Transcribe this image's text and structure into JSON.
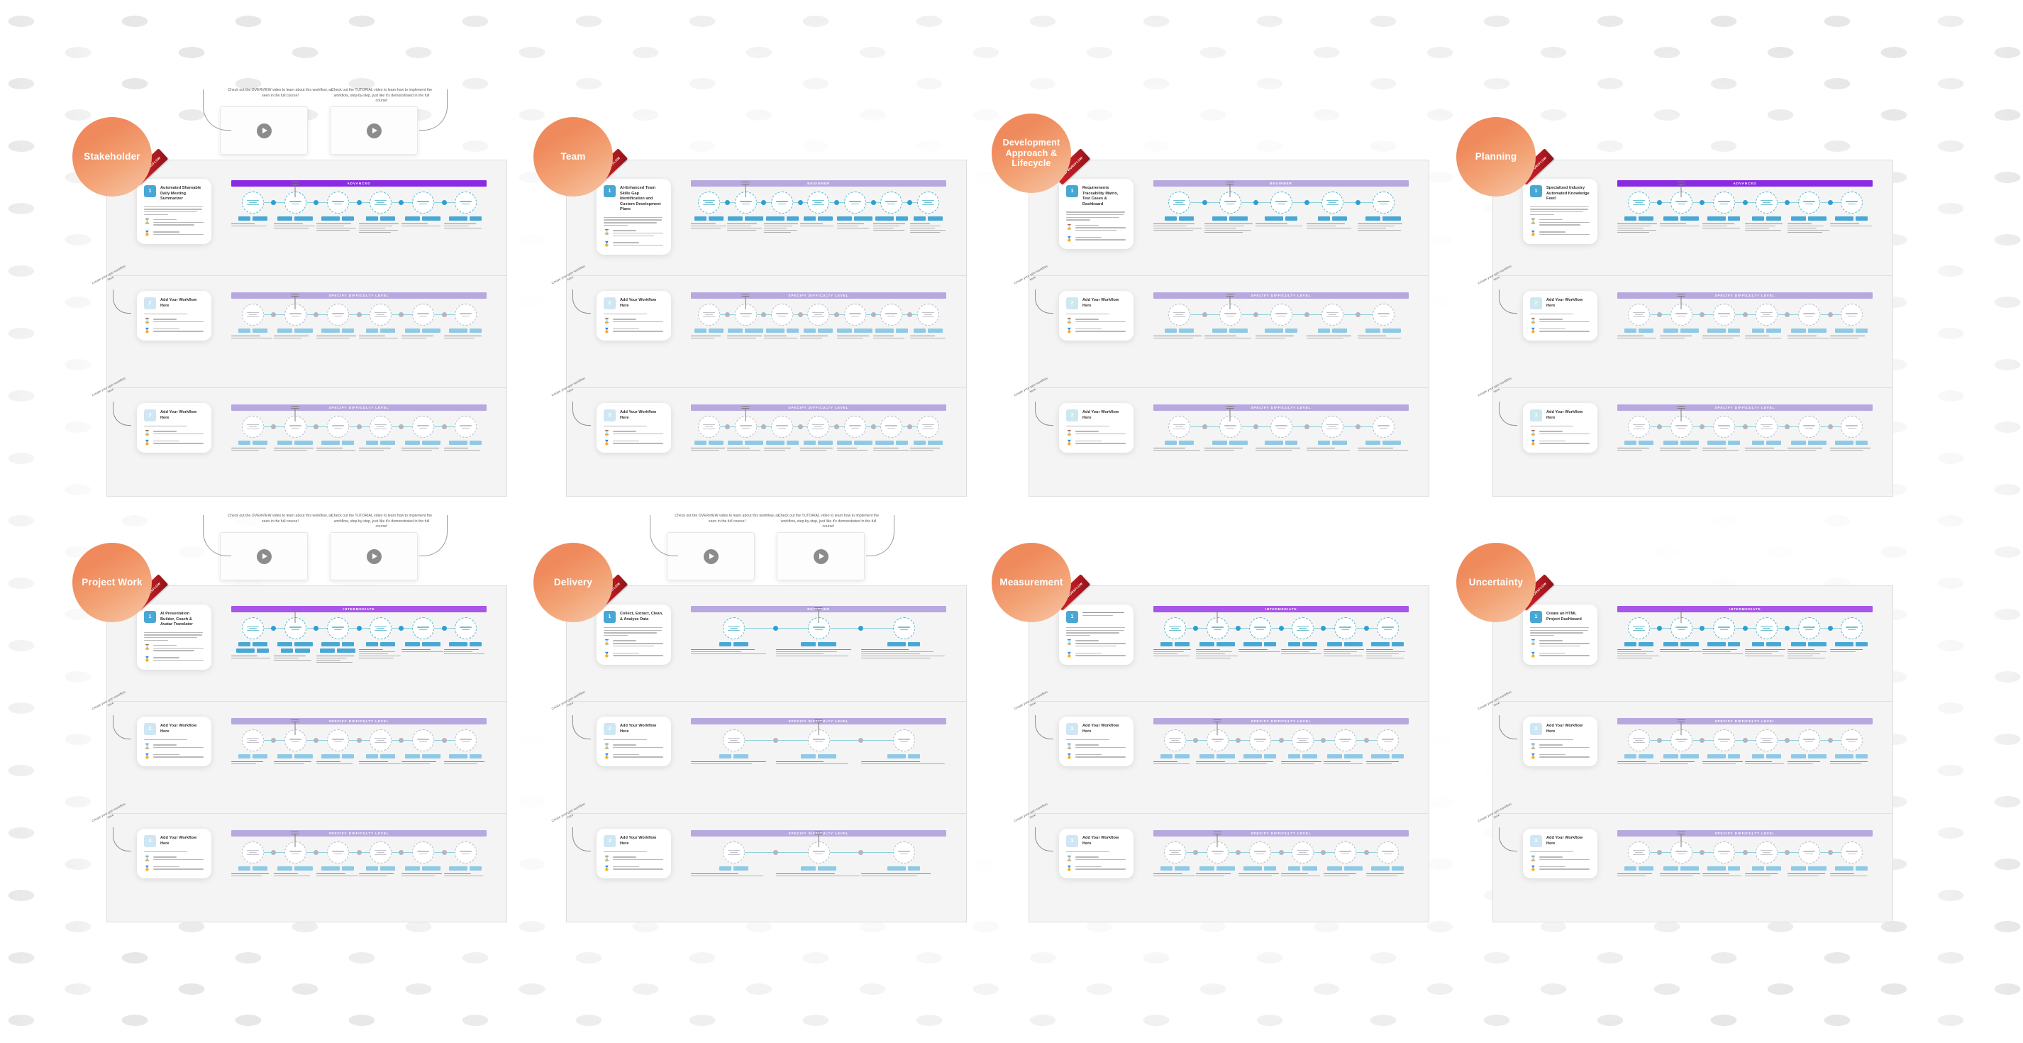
{
  "colors": {
    "bubble_start": "#f08a5d",
    "bubble_end": "#f6c7a8",
    "advanced": "#8a2be2",
    "intermediate": "#a855e8",
    "beginner": "#b8a8e0",
    "node_accent": "#2e9fd4",
    "chip": "#49a7d4",
    "ribbon": "#c2202a",
    "board_bg": "#f4f4f4"
  },
  "video_popovers": [
    {
      "note": "Check out the OVERVIEW video to learn about this workflow, as seen in the full course!",
      "icon": "play-icon"
    },
    {
      "note": "Check out the TUTORIAL video to learn how to implement the workflow, step-by-step, just like it's demonstrated in the full course!",
      "icon": "play-icon"
    }
  ],
  "placeholder_note": "Create your own workflow here",
  "placeholder_title": "Add Your Workflow Here",
  "placeholder_banner": "SPECIFY DIFFICULTY LEVEL",
  "ribbon_label": "NEW WORKFLOW",
  "meta_icons": [
    "hourglass-icon",
    "medal-icon"
  ],
  "levels": {
    "beginner": "BEGINNER",
    "intermediate": "INTERMEDIATE",
    "advanced": "ADVANCED"
  },
  "clusters": [
    {
      "id": "stakeholder",
      "label": "Stakeholder",
      "has_videos": true,
      "rows": [
        {
          "num": "1",
          "title": "Automated Shareable Daily Meeting Summarizer",
          "banner": "ADVANCED",
          "level": "advanced",
          "steps": 6,
          "placeholder": false
        },
        {
          "num": "2",
          "title": "Add Your Workflow Here",
          "banner": "SPECIFY DIFFICULTY LEVEL",
          "level": "beginner",
          "steps": 6,
          "placeholder": true
        },
        {
          "num": "3",
          "title": "Add Your Workflow Here",
          "banner": "SPECIFY DIFFICULTY LEVEL",
          "level": "beginner",
          "steps": 6,
          "placeholder": true
        }
      ]
    },
    {
      "id": "team",
      "label": "Team",
      "has_videos": false,
      "rows": [
        {
          "num": "1",
          "title": "AI-Enhanced Team Skills Gap Identification and Custom Development Plans",
          "banner": "BEGINNER",
          "level": "beginner",
          "steps": 7,
          "placeholder": false
        },
        {
          "num": "2",
          "title": "Add Your Workflow Here",
          "banner": "SPECIFY DIFFICULTY LEVEL",
          "level": "beginner",
          "steps": 7,
          "placeholder": true
        },
        {
          "num": "3",
          "title": "Add Your Workflow Here",
          "banner": "SPECIFY DIFFICULTY LEVEL",
          "level": "beginner",
          "steps": 7,
          "placeholder": true
        }
      ]
    },
    {
      "id": "development-approach-lifecycle",
      "label": "Development Approach & Lifecycle",
      "has_videos": false,
      "rows": [
        {
          "num": "1",
          "title": "Requirements Traceability Matrix, Test Cases & Dashboard",
          "banner": "BEGINNER",
          "level": "beginner",
          "steps": 5,
          "placeholder": false
        },
        {
          "num": "2",
          "title": "Add Your Workflow Here",
          "banner": "SPECIFY DIFFICULTY LEVEL",
          "level": "beginner",
          "steps": 5,
          "placeholder": true
        },
        {
          "num": "3",
          "title": "Add Your Workflow Here",
          "banner": "SPECIFY DIFFICULTY LEVEL",
          "level": "beginner",
          "steps": 5,
          "placeholder": true
        }
      ]
    },
    {
      "id": "planning",
      "label": "Planning",
      "has_videos": false,
      "rows": [
        {
          "num": "1",
          "title": "Specialized Industry Automated Knowledge Feed",
          "banner": "ADVANCED",
          "level": "advanced",
          "steps": 6,
          "placeholder": false
        },
        {
          "num": "2",
          "title": "Add Your Workflow Here",
          "banner": "SPECIFY DIFFICULTY LEVEL",
          "level": "beginner",
          "steps": 6,
          "placeholder": true
        },
        {
          "num": "3",
          "title": "Add Your Workflow Here",
          "banner": "SPECIFY DIFFICULTY LEVEL",
          "level": "beginner",
          "steps": 6,
          "placeholder": true
        }
      ]
    },
    {
      "id": "project-work",
      "label": "Project Work",
      "has_videos": true,
      "rows": [
        {
          "num": "1",
          "title": "AI Presentation Builder, Coach & Avatar Translator",
          "banner": "INTERMEDIATE",
          "level": "intermediate",
          "steps": 6,
          "placeholder": false
        },
        {
          "num": "2",
          "title": "Add Your Workflow Here",
          "banner": "SPECIFY DIFFICULTY LEVEL",
          "level": "beginner",
          "steps": 6,
          "placeholder": true
        },
        {
          "num": "3",
          "title": "Add Your Workflow Here",
          "banner": "SPECIFY DIFFICULTY LEVEL",
          "level": "beginner",
          "steps": 6,
          "placeholder": true
        }
      ]
    },
    {
      "id": "delivery",
      "label": "Delivery",
      "has_videos": true,
      "rows": [
        {
          "num": "1",
          "title": "Collect, Extract, Clean, & Analyze Data",
          "banner": "BEGINNER",
          "level": "beginner",
          "steps": 3,
          "placeholder": false
        },
        {
          "num": "2",
          "title": "Add Your Workflow Here",
          "banner": "SPECIFY DIFFICULTY LEVEL",
          "level": "beginner",
          "steps": 3,
          "placeholder": true
        },
        {
          "num": "3",
          "title": "Add Your Workflow Here",
          "banner": "SPECIFY DIFFICULTY LEVEL",
          "level": "beginner",
          "steps": 3,
          "placeholder": true
        }
      ]
    },
    {
      "id": "measurement",
      "label": "Measurement",
      "has_videos": false,
      "rows": [
        {
          "num": "1",
          "title": "",
          "banner": "INTERMEDIATE",
          "level": "intermediate",
          "steps": 6,
          "placeholder": false
        },
        {
          "num": "2",
          "title": "Add Your Workflow Here",
          "banner": "SPECIFY DIFFICULTY LEVEL",
          "level": "beginner",
          "steps": 6,
          "placeholder": true
        },
        {
          "num": "3",
          "title": "Add Your Workflow Here",
          "banner": "SPECIFY DIFFICULTY LEVEL",
          "level": "beginner",
          "steps": 6,
          "placeholder": true
        }
      ]
    },
    {
      "id": "uncertainty",
      "label": "Uncertainty",
      "has_videos": false,
      "rows": [
        {
          "num": "1",
          "title": "Create an HTML Project Dashboard",
          "banner": "INTERMEDIATE",
          "level": "intermediate",
          "steps": 6,
          "placeholder": false
        },
        {
          "num": "2",
          "title": "Add Your Workflow Here",
          "banner": "SPECIFY DIFFICULTY LEVEL",
          "level": "beginner",
          "steps": 6,
          "placeholder": true
        },
        {
          "num": "3",
          "title": "Add Your Workflow Here",
          "banner": "SPECIFY DIFFICULTY LEVEL",
          "level": "beginner",
          "steps": 6,
          "placeholder": true
        }
      ]
    }
  ]
}
